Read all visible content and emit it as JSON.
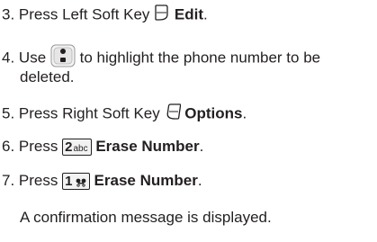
{
  "steps": [
    {
      "number": "3.",
      "pre": "Press Left Soft Key",
      "icon": "left-soft-key-icon",
      "action": "Edit",
      "post": "."
    },
    {
      "number": "4.",
      "pre": "Use",
      "icon": "nav-key-icon",
      "post": "to highlight the phone number to be",
      "post2": "deleted."
    },
    {
      "number": "5.",
      "pre": "Press Right Soft Key",
      "icon": "right-soft-key-icon",
      "action": "Options",
      "post": "."
    },
    {
      "number": "6.",
      "pre": "Press",
      "key_num": "2",
      "key_sub": "abc",
      "action": "Erase Number",
      "post": "."
    },
    {
      "number": "7.",
      "pre": "Press",
      "key_num": "1",
      "key_sub": "",
      "action": "Erase Number",
      "post": "."
    }
  ],
  "note": "A confirmation message is displayed."
}
